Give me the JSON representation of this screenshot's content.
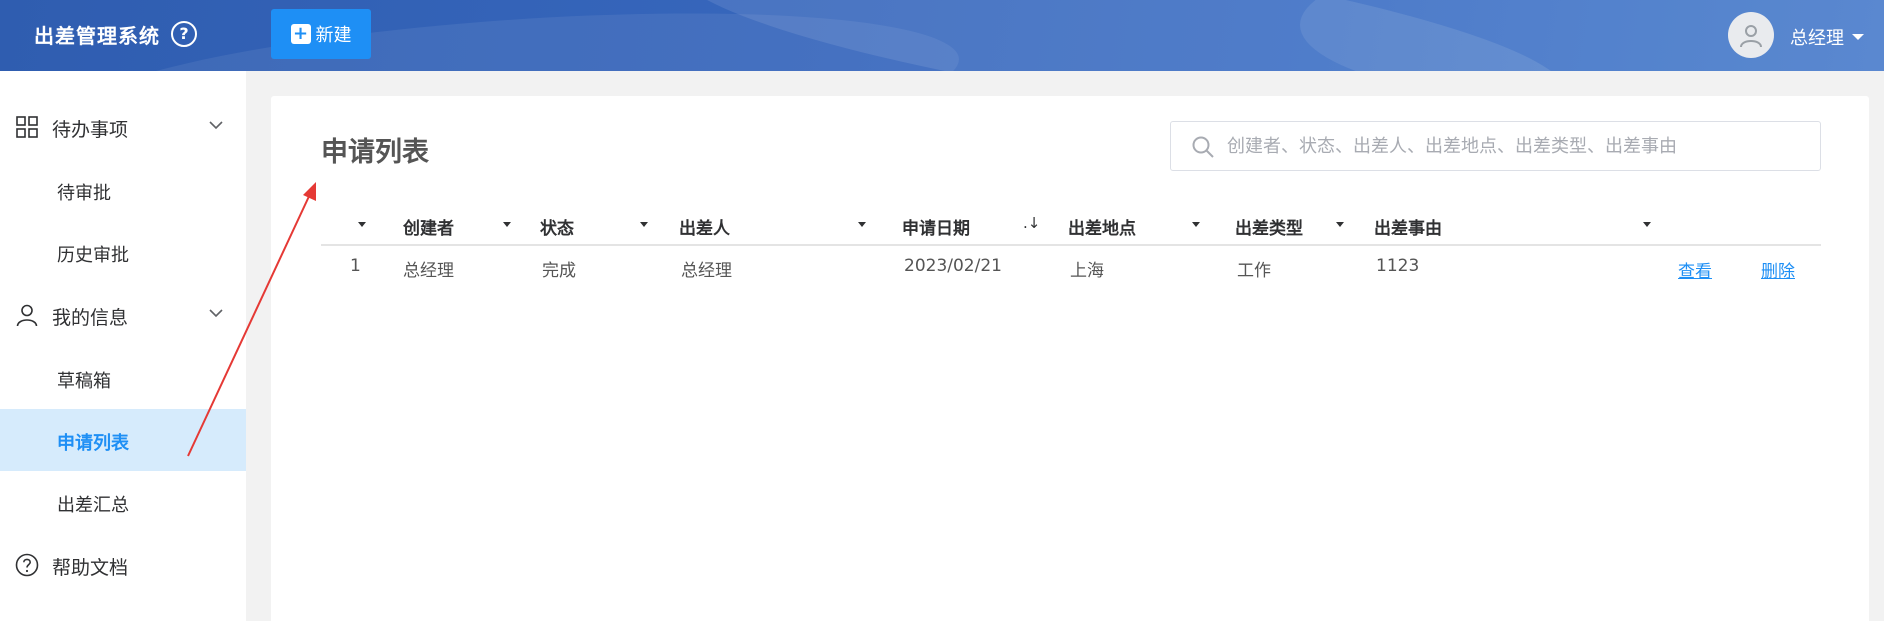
{
  "header": {
    "app_title": "出差管理系统",
    "help_icon_glyph": "?",
    "new_button_label": "新建",
    "user_name": "总经理",
    "accent_color": "#1e8ff5"
  },
  "sidebar": {
    "groups": [
      {
        "label": "待办事项",
        "icon": "grid-icon",
        "items": [
          "待审批",
          "历史审批"
        ]
      },
      {
        "label": "我的信息",
        "icon": "user-icon",
        "items": [
          "草稿箱",
          "申请列表",
          "出差汇总"
        ]
      },
      {
        "label": "帮助文档",
        "icon": "help-circle-icon",
        "items": []
      }
    ],
    "active_item": "申请列表"
  },
  "main": {
    "title": "申请列表",
    "search_placeholder": "创建者、状态、出差人、出差地点、出差类型、出差事由",
    "columns": [
      "",
      "创建者",
      "状态",
      "出差人",
      "申请日期",
      "出差地点",
      "出差类型",
      "出差事由"
    ],
    "rows": [
      {
        "index": "1",
        "creator": "总经理",
        "status": "完成",
        "traveler": "总经理",
        "date": "2023/02/21",
        "location": "上海",
        "type": "工作",
        "reason": "1123",
        "actions": [
          "查看",
          "删除"
        ]
      }
    ]
  }
}
